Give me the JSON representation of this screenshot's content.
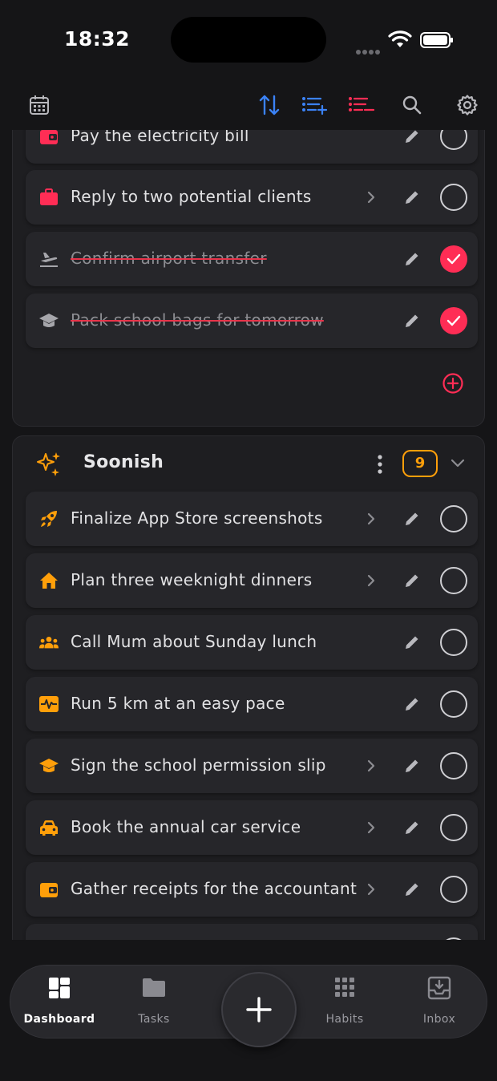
{
  "status_bar": {
    "time": "18:32"
  },
  "colors": {
    "accent_blue": "#3b82f6",
    "accent_red": "#ff2d55",
    "accent_orange": "#ff9f0a",
    "background": "#151517"
  },
  "toolbar": {
    "icons": [
      "calendar-icon",
      "sort-icon",
      "add-list-icon",
      "remove-list-icon",
      "search-icon",
      "gear-icon"
    ]
  },
  "today_section": {
    "rows": [
      {
        "icon": "wallet-icon",
        "label": "Pay the electricity bill",
        "has_chevron": false,
        "done": false
      },
      {
        "icon": "briefcase-icon",
        "label": "Reply to two potential clients",
        "has_chevron": true,
        "done": false
      },
      {
        "icon": "plane-icon",
        "label": "Confirm airport transfer",
        "has_chevron": false,
        "done": true
      },
      {
        "icon": "school-icon",
        "label": "Pack school bags for tomorrow",
        "has_chevron": false,
        "done": true
      }
    ]
  },
  "soonish_section": {
    "title": "Soonish",
    "count": "9",
    "rows": [
      {
        "icon": "rocket-icon",
        "label": "Finalize App Store screenshots",
        "has_chevron": true,
        "done": false
      },
      {
        "icon": "home-icon",
        "label": "Plan three weeknight dinners",
        "has_chevron": true,
        "done": false
      },
      {
        "icon": "people-icon",
        "label": "Call Mum about Sunday lunch",
        "has_chevron": false,
        "done": false
      },
      {
        "icon": "heartbeat-icon",
        "label": "Run 5 km at an easy pace",
        "has_chevron": false,
        "done": false
      },
      {
        "icon": "school-icon",
        "label": "Sign the school permission slip",
        "has_chevron": true,
        "done": false
      },
      {
        "icon": "car-icon",
        "label": "Book the annual car service",
        "has_chevron": true,
        "done": false
      },
      {
        "icon": "wallet-icon",
        "label": "Gather receipts for the accountant",
        "has_chevron": true,
        "done": false
      }
    ]
  },
  "nav": {
    "dashboard": "Dashboard",
    "tasks": "Tasks",
    "habits": "Habits",
    "inbox": "Inbox"
  }
}
